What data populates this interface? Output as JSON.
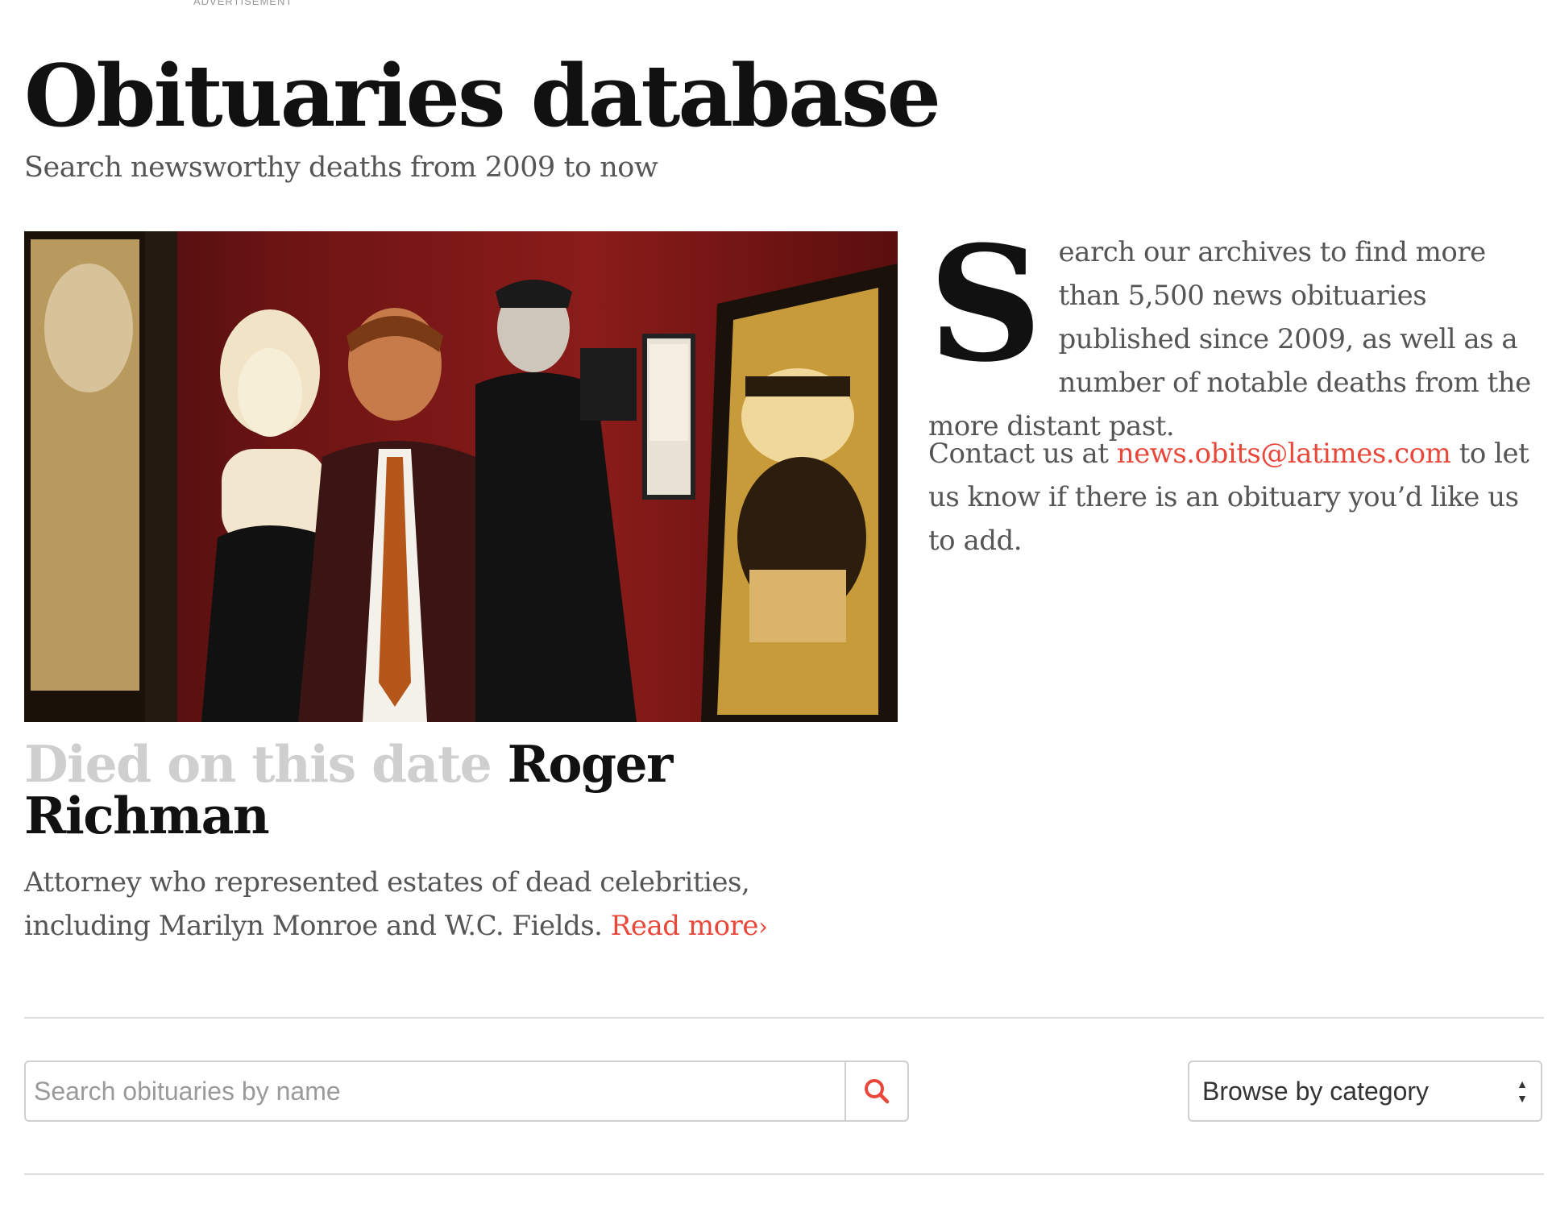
{
  "ad_label": "ADVERTISEMENT",
  "header": {
    "title": "Obituaries database",
    "subtitle": "Search newsworthy deaths from 2009 to now"
  },
  "feature": {
    "died_label": "Died on this date",
    "name": "Roger Richman",
    "summary": "Attorney who represented estates of dead celebrities, including Marilyn Monroe and W.C. Fields.",
    "read_more": "Read more",
    "read_more_icon": "chevron-right-icon"
  },
  "intro": {
    "dropcap": "S",
    "text": "earch our archives to find more than 5,500 news obituaries published since 2009, as well as a number of notable deaths from the more distant past."
  },
  "contact": {
    "before": "Contact us at ",
    "email": "news.obits@latimes.com",
    "after": " to let us know if there is an obituary you’d like us to add."
  },
  "search": {
    "placeholder": "Search obituaries by name",
    "value": "",
    "icon": "search-icon"
  },
  "category_select": {
    "label": "Browse by category",
    "icon": "select-arrows-icon"
  },
  "colors": {
    "accent": "#e8473a",
    "title": "#111111",
    "body_text": "#555555",
    "muted_heading": "#cfcfcf",
    "rule": "#dcdcdc"
  }
}
